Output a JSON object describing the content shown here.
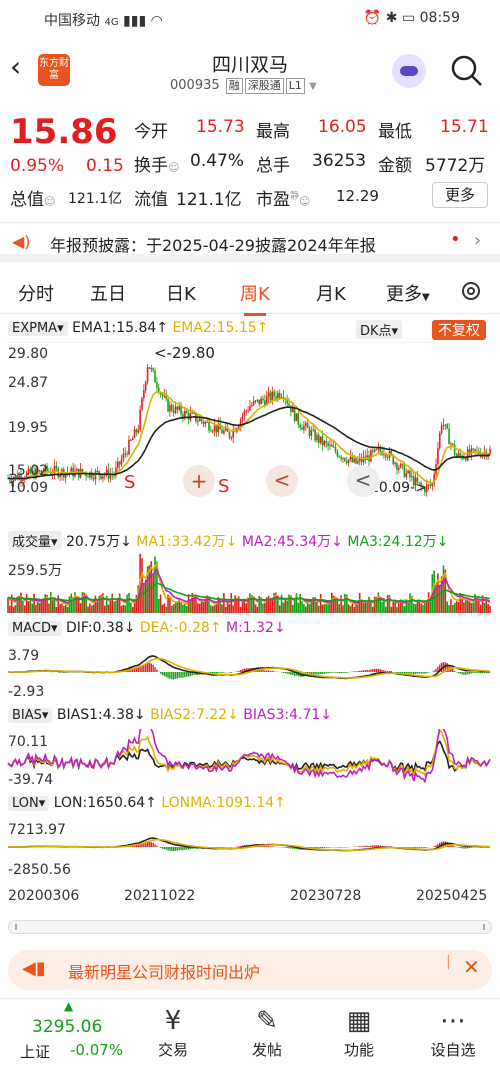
{
  "status_bar": {
    "carrier": "中国移动",
    "network": "4G",
    "time": "08:59"
  },
  "header": {
    "name": "四川双马",
    "code": "000935",
    "tags": [
      "融",
      "深股通",
      "L1"
    ],
    "logo_text": "东方财富"
  },
  "quote": {
    "price": "15.86",
    "change_pct": "0.95%",
    "change": "0.15",
    "open_label": "今开",
    "open": "15.73",
    "high_label": "最高",
    "high": "16.05",
    "low_label": "最低",
    "low": "15.71",
    "turnover_label": "换手",
    "turnover": "0.47%",
    "volume_label": "总手",
    "volume": "36253",
    "amount_label": "金额",
    "amount": "5772万",
    "total_cap_label": "总值",
    "total_cap": "121.1亿",
    "float_cap_label": "流值",
    "float_cap": "121.1亿",
    "pe_label": "市盈",
    "pe_sup": "静",
    "pe": "12.29",
    "more": "更多"
  },
  "notice": {
    "text": "年报预披露：于2025-04-29披露2024年年报"
  },
  "tabs": [
    "分时",
    "五日",
    "日K",
    "周K",
    "月K",
    "更多"
  ],
  "active_tab": "周K",
  "main_chart": {
    "indicator": "EXPMA",
    "ema1": "EMA1:15.84↑",
    "ema2": "EMA2:15.15↑",
    "dk": "DK点",
    "fq": "不复权",
    "y_labels": [
      "29.80",
      "24.87",
      "19.95",
      "15.02",
      "10.09"
    ],
    "max_marker": "<-29.80",
    "min_marker": "10.09->",
    "signals": [
      "S",
      "+",
      "S",
      "<",
      "<"
    ]
  },
  "volume_chart": {
    "name": "成交量",
    "vol": "20.75万↓",
    "ma1": "MA1:33.42万↓",
    "ma2": "MA2:45.34万↓",
    "ma3": "MA3:24.12万↓",
    "y_label": "259.5万"
  },
  "macd_chart": {
    "name": "MACD",
    "dif": "DIF:0.38↓",
    "dea": "DEA:-0.28↑",
    "m": "M:1.32↓",
    "y_top": "3.79",
    "y_bottom": "-2.93"
  },
  "bias_chart": {
    "name": "BIAS",
    "b1": "BIAS1:4.38↓",
    "b2": "BIAS2:7.22↓",
    "b3": "BIAS3:4.71↓",
    "y_top": "70.11",
    "y_bottom": "-39.74"
  },
  "lon_chart": {
    "name": "LON",
    "lon": "LON:1650.64↑",
    "lonma": "LONMA:1091.14↑",
    "y_top": "7213.97",
    "y_bottom": "-2850.56"
  },
  "x_axis": [
    "20200306",
    "20211022",
    "20230728",
    "20250425"
  ],
  "banner": {
    "text": "最新明星公司财报时间出炉"
  },
  "bottom_nav": {
    "index_value": "3295.06",
    "index_name": "上证",
    "index_change": "-0.07%",
    "items": [
      "交易",
      "发帖",
      "功能",
      "设自选"
    ]
  },
  "colors": {
    "up": "#e02020",
    "down": "#14a014",
    "accent": "#e8541e"
  }
}
